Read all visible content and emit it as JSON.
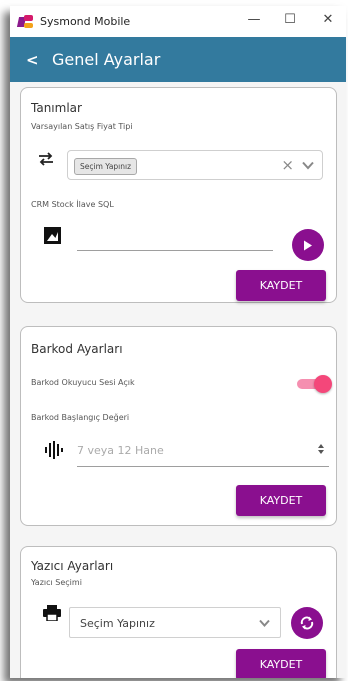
{
  "window": {
    "title": "Sysmond Mobile",
    "minimize": "—",
    "maximize": "☐",
    "close": "✕"
  },
  "appbar": {
    "back": "<",
    "title": "Genel Ayarlar"
  },
  "tanimlar": {
    "title": "Tanımlar",
    "fiyat_label": "Varsayılan Satış Fiyat Tipi",
    "fiyat_chip": "Seçim Yapınız",
    "fiyat_clear": "×",
    "crm_label": "CRM Stock İlave SQL",
    "crm_value": "",
    "save": "KAYDET"
  },
  "barkod": {
    "title": "Barkod Ayarları",
    "ses_label": "Barkod Okuyucu Sesi Açık",
    "ses_on": true,
    "baslangic_label": "Barkod Başlangıç Değeri",
    "baslangic_value": "7 veya 12 Hane",
    "save": "KAYDET"
  },
  "yazici": {
    "title": "Yazıcı Ayarları",
    "secim_label": "Yazıcı Seçimi",
    "select_value": "Seçim Yapınız",
    "save": "KAYDET"
  },
  "colors": {
    "accent": "#8a0f8f",
    "appbar": "#337a9e",
    "toggle": "#f4477a"
  }
}
